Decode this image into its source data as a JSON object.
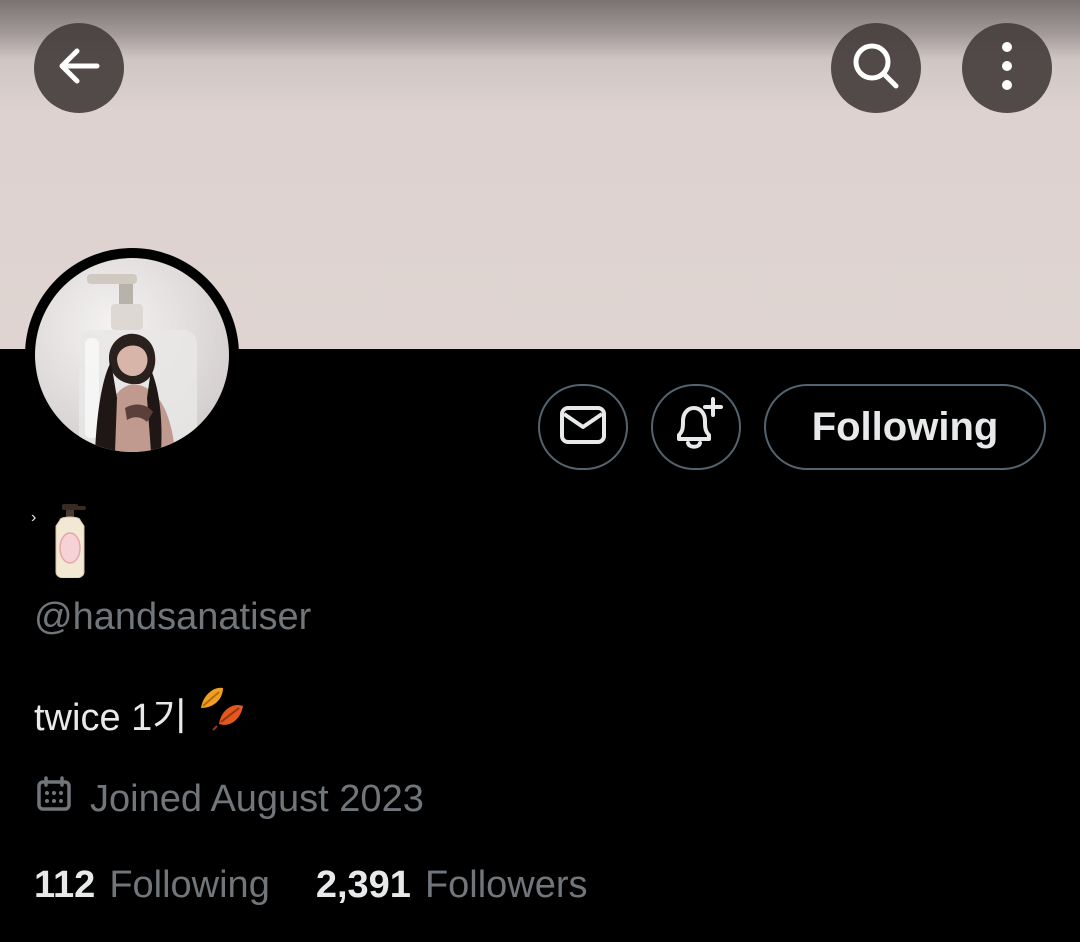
{
  "profile": {
    "display_name_mark": "›",
    "display_name_emoji": "lotion-bottle-emoji",
    "handle": "@handsanatiser",
    "bio_text": "twice 1기",
    "bio_emoji": "fallen-leaves-emoji",
    "joined": "Joined August 2023",
    "following_count": "112",
    "following_label": "Following",
    "followers_count": "2,391",
    "followers_label": "Followers"
  },
  "actions": {
    "follow_state_label": "Following"
  },
  "icons": {
    "back": "back-arrow-icon",
    "search": "search-icon",
    "more": "more-vertical-icon",
    "message": "envelope-icon",
    "notify": "bell-plus-icon",
    "calendar": "calendar-icon"
  },
  "colors": {
    "background": "#000000",
    "primary_text": "#e7e9ea",
    "secondary_text": "#71767b",
    "button_border": "#536471",
    "banner": "#dfd4d1"
  }
}
